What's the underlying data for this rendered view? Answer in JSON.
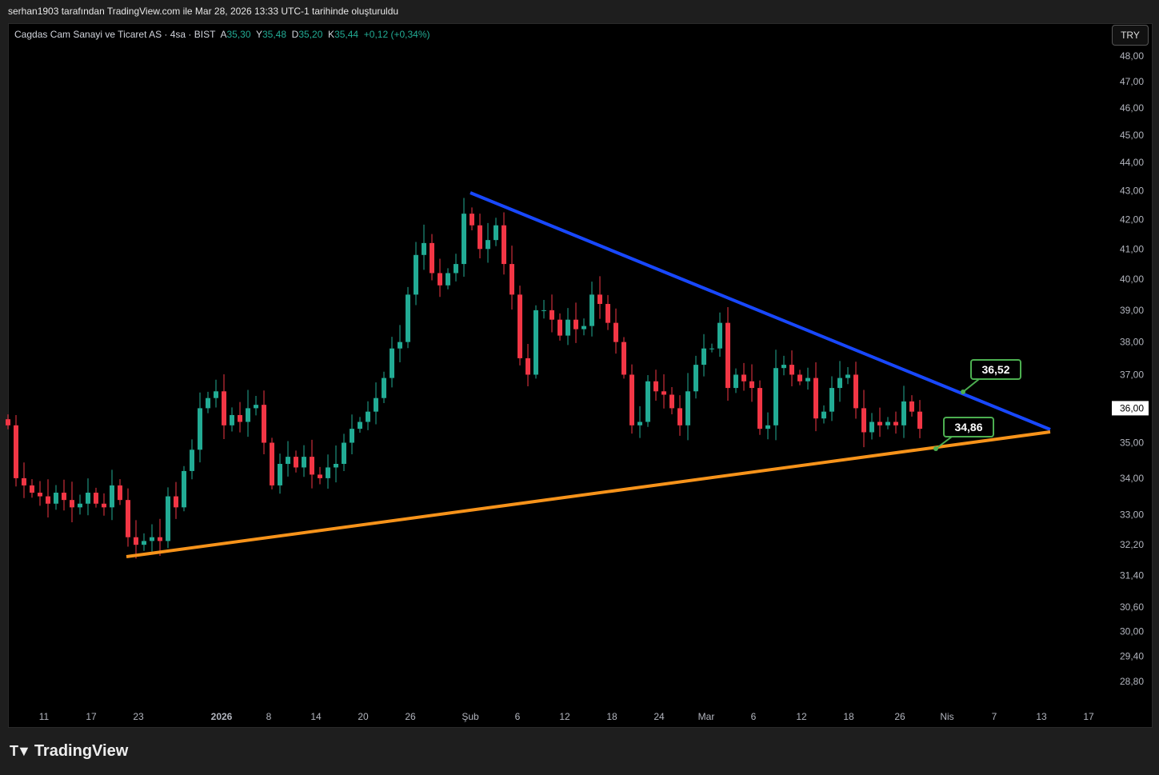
{
  "credit": "serhan1903 tarafından TradingView.com ile Mar 28, 2026 13:33 UTC-1 tarihinde oluşturuldu",
  "legend": {
    "symbol": "Cagdas Cam Sanayi ve Ticaret AS · 4sa · BIST",
    "o_label": "A",
    "o": "35,30",
    "h_label": "Y",
    "h": "35,48",
    "l_label": "D",
    "l": "35,20",
    "c_label": "K",
    "c": "35,44",
    "change": "+0,12 (+0,34%)"
  },
  "currency": "TRY",
  "logo": "TradingView",
  "colors": {
    "up": "#22ab94",
    "down": "#f23645",
    "resistance": "#1848ff",
    "support": "#f7931a",
    "label_border": "#4caf50"
  },
  "chart_data": {
    "type": "candlestick",
    "scale": "log",
    "ylim": [
      28.8,
      48.0
    ],
    "y_ticks": [
      "48,00",
      "47,00",
      "46,00",
      "45,00",
      "44,00",
      "43,00",
      "42,00",
      "41,00",
      "40,00",
      "39,00",
      "38,00",
      "37,00",
      "36,00",
      "35,00",
      "34,00",
      "33,00",
      "32,20",
      "31,40",
      "30,60",
      "30,00",
      "29,40",
      "28,80"
    ],
    "y_tick_values": [
      48,
      47,
      46,
      45,
      44,
      43,
      42,
      41,
      40,
      39,
      38,
      37,
      36,
      35,
      34,
      33,
      32.2,
      31.4,
      30.6,
      30,
      29.4,
      28.8
    ],
    "current_price_label": "36,00",
    "x_ticks": [
      "11",
      "17",
      "23",
      "2026",
      "8",
      "14",
      "20",
      "26",
      "Şub",
      "6",
      "12",
      "18",
      "24",
      "Mar",
      "6",
      "12",
      "18",
      "26",
      "Nis",
      "7",
      "13",
      "17"
    ],
    "closes": [
      35.5,
      34.0,
      33.8,
      33.6,
      33.5,
      33.3,
      33.6,
      33.4,
      33.2,
      33.3,
      33.6,
      33.3,
      33.2,
      33.8,
      33.4,
      32.4,
      32.2,
      32.3,
      32.4,
      32.3,
      33.5,
      33.2,
      34.2,
      34.8,
      36.0,
      36.3,
      36.5,
      35.5,
      35.8,
      35.6,
      36.0,
      36.1,
      35.0,
      33.8,
      34.4,
      34.6,
      34.3,
      34.6,
      34.1,
      34.0,
      34.3,
      34.4,
      35.0,
      35.4,
      35.6,
      35.9,
      36.3,
      36.9,
      37.8,
      38.0,
      39.5,
      40.8,
      41.2,
      40.2,
      39.8,
      40.2,
      40.5,
      42.2,
      41.8,
      41.0,
      41.3,
      41.8,
      40.5,
      39.5,
      37.5,
      37.0,
      39.0,
      39.0,
      38.7,
      38.2,
      38.7,
      38.4,
      38.5,
      39.5,
      39.2,
      38.6,
      38.0,
      37.0,
      35.5,
      35.6,
      36.8,
      36.5,
      36.4,
      36.0,
      35.5,
      36.5,
      37.3,
      37.8,
      37.8,
      38.6,
      36.6,
      37.0,
      36.8,
      36.6,
      35.4,
      35.5,
      37.2,
      37.3,
      37.0,
      36.8,
      36.9,
      35.7,
      35.9,
      36.6,
      36.9,
      37.0,
      36.0,
      35.3,
      35.6,
      35.5,
      35.6,
      35.5,
      36.2,
      35.9,
      35.4
    ],
    "annotations": [
      {
        "type": "trendline",
        "name": "resistance",
        "label": "36,52"
      },
      {
        "type": "trendline",
        "name": "support",
        "label": "34,86"
      }
    ]
  }
}
